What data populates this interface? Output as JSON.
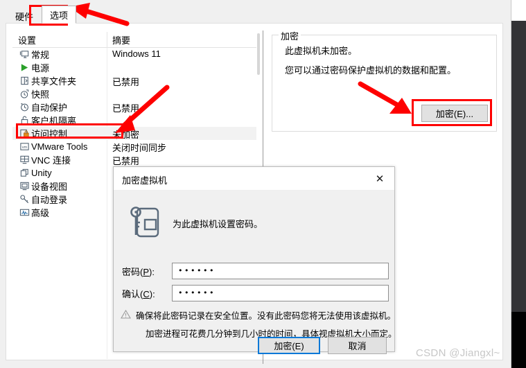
{
  "tabs": [
    {
      "label": "硬件",
      "active": false
    },
    {
      "label": "选项",
      "active": true
    }
  ],
  "list": {
    "columns": {
      "settings": "设置",
      "summary": "摘要"
    },
    "rows": [
      {
        "icon": "monitor-icon",
        "label": "常规",
        "summary": "Windows 11",
        "selected": false
      },
      {
        "icon": "play-triangle-icon",
        "label": "电源",
        "summary": "",
        "selected": false
      },
      {
        "icon": "folder-share-icon",
        "label": "共享文件夹",
        "summary": "已禁用",
        "selected": false
      },
      {
        "icon": "camera-clock-icon",
        "label": "快照",
        "summary": "",
        "selected": false
      },
      {
        "icon": "clock-back-icon",
        "label": "自动保护",
        "summary": "已禁用",
        "selected": false
      },
      {
        "icon": "lock-open-icon",
        "label": "客户机隔离",
        "summary": "",
        "selected": false
      },
      {
        "icon": "access-lock-icon",
        "label": "访问控制",
        "summary": "未加密",
        "selected": true
      },
      {
        "icon": "vm-tools-icon",
        "label": "VMware Tools",
        "summary": "关闭时间同步",
        "selected": false
      },
      {
        "icon": "vnc-icon",
        "label": "VNC 连接",
        "summary": "已禁用",
        "selected": false
      },
      {
        "icon": "unity-icon",
        "label": "Unity",
        "summary": "",
        "selected": false
      },
      {
        "icon": "device-view-icon",
        "label": "设备视图",
        "summary": "",
        "selected": false
      },
      {
        "icon": "auto-login-icon",
        "label": "自动登录",
        "summary": "",
        "selected": false
      },
      {
        "icon": "advanced-icon",
        "label": "高级",
        "summary": "",
        "selected": false
      }
    ]
  },
  "encryption_panel": {
    "legend": "加密",
    "line1": "此虚拟机未加密。",
    "line2": "您可以通过密码保护虚拟机的数据和配置。",
    "button_label": "加密(E)..."
  },
  "dialog": {
    "title": "加密虚拟机",
    "close_glyph": "✕",
    "lead_text": "为此虚拟机设置密码。",
    "fields": [
      {
        "label_prefix": "密码(",
        "label_key": "P",
        "label_suffix": "):",
        "value": "••••••"
      },
      {
        "label_prefix": "确认(",
        "label_key": "C",
        "label_suffix": "):",
        "value": "••••••"
      }
    ],
    "warning_line1": "确保将此密码记录在安全位置。没有此密码您将无法使用该虚拟机。",
    "warning_line2": "加密进程可花费几分钟到几小时的时间，具体视虚拟机大小而定。",
    "ok_label": "加密(E)",
    "cancel_label": "取消"
  },
  "annotations": {
    "highlight_color": "#fe0000",
    "arrow_color": "#fe0000"
  },
  "watermark": "CSDN @Jiangxl~"
}
